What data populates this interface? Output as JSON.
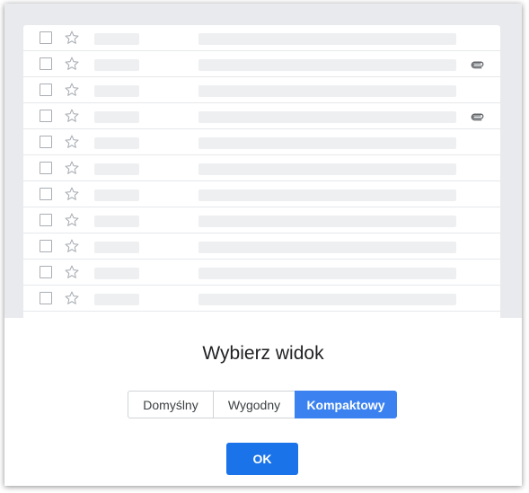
{
  "dialog": {
    "title": "Wybierz widok",
    "ok_label": "OK"
  },
  "view_options": [
    {
      "label": "Domyślny",
      "selected": false
    },
    {
      "label": "Wygodny",
      "selected": false
    },
    {
      "label": "Kompaktowy",
      "selected": true
    }
  ],
  "preview": {
    "rows": [
      {
        "attachment": false
      },
      {
        "attachment": true
      },
      {
        "attachment": false
      },
      {
        "attachment": true
      },
      {
        "attachment": false
      },
      {
        "attachment": false
      },
      {
        "attachment": false
      },
      {
        "attachment": false
      },
      {
        "attachment": false
      },
      {
        "attachment": false
      },
      {
        "attachment": false
      }
    ],
    "icons": {
      "checkbox": "checkbox-icon",
      "star": "star-icon",
      "attachment": "paperclip-icon"
    }
  },
  "colors": {
    "accent": "#3b82f0",
    "ok_button": "#1a73e8",
    "preview_background": "#e8eaed",
    "placeholder": "#eeeff1"
  }
}
